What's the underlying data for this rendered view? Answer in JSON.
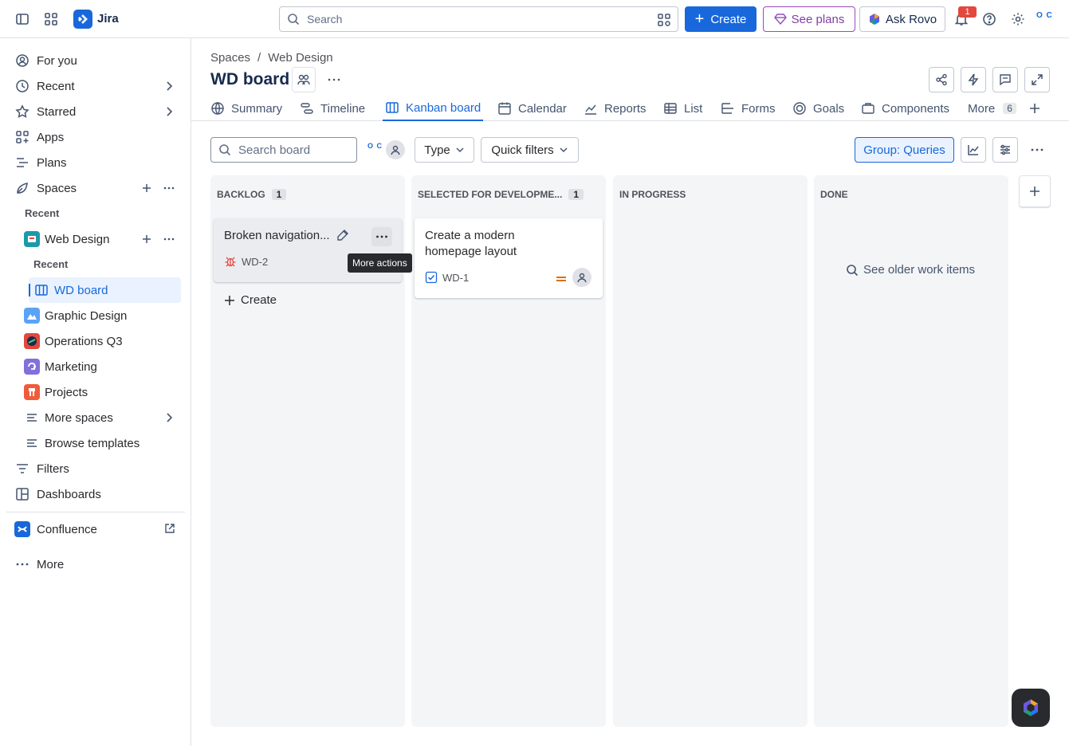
{
  "topbar": {
    "app_name": "Jira",
    "search_placeholder": "Search",
    "create_label": "Create",
    "plans_label": "See plans",
    "rovo_label": "Ask Rovo",
    "notif_count": "1",
    "avatar_text": "O C",
    "colors": {
      "primary": "#1868db",
      "plans": "#803fa5",
      "badge": "#e2483d"
    }
  },
  "sidebar": {
    "for_you": "For you",
    "recent": "Recent",
    "starred": "Starred",
    "apps": "Apps",
    "plans": "Plans",
    "spaces": "Spaces",
    "recent_label": "Recent",
    "web_design": "Web Design",
    "recent_label_2": "Recent",
    "wd_board": "WD board",
    "graphic_design": "Graphic Design",
    "operations_q3": "Operations Q3",
    "marketing": "Marketing",
    "projects": "Projects",
    "more_spaces": "More spaces",
    "browse_templates": "Browse templates",
    "filters": "Filters",
    "dashboards": "Dashboards",
    "confluence": "Confluence",
    "more": "More"
  },
  "main": {
    "breadcrumb": {
      "spaces": "Spaces",
      "sep": "/",
      "web_design": "Web Design"
    },
    "title": "WD board",
    "tabs": {
      "summary": "Summary",
      "timeline": "Timeline",
      "kanban": "Kanban board",
      "calendar": "Calendar",
      "reports": "Reports",
      "list": "List",
      "forms": "Forms",
      "goals": "Goals",
      "components": "Components",
      "more": "More",
      "more_count": "6"
    },
    "toolbar": {
      "search_placeholder": "Search board",
      "avatar_text": "O C",
      "type_filter": "Type",
      "quick_filters": "Quick filters",
      "group_by": "Group: Queries"
    },
    "columns": {
      "backlog": {
        "name": "BACKLOG",
        "count": "1"
      },
      "selected": {
        "name": "SELECTED FOR DEVELOPME...",
        "count": "1"
      },
      "in_progress": {
        "name": "IN PROGRESS"
      },
      "done": {
        "name": "DONE",
        "older": "See older work items"
      }
    },
    "cards": {
      "wd2": {
        "title": "Broken navigation...",
        "key": "WD-2",
        "type": "bug-icon"
      },
      "wd1": {
        "title_line1": "Create a modern",
        "title_line2": "homepage layout",
        "key": "WD-1",
        "type": "task-icon",
        "priority": "medium"
      }
    },
    "create_label": "Create",
    "tooltip": "More actions"
  }
}
